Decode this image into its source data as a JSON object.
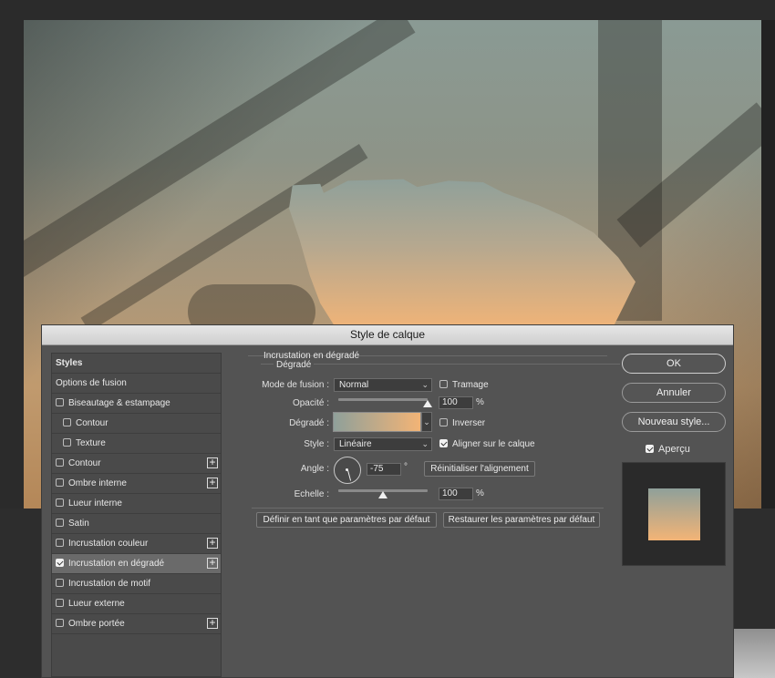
{
  "dialog": {
    "title": "Style de calque"
  },
  "styles_list": [
    {
      "label": "Styles",
      "header": true
    },
    {
      "label": "Options de fusion",
      "header": false
    },
    {
      "label": "Biseautage & estampage",
      "checked": false
    },
    {
      "label": "Contour",
      "checked": false,
      "indent": true
    },
    {
      "label": "Texture",
      "checked": false,
      "indent": true
    },
    {
      "label": "Contour",
      "checked": false,
      "plus": true
    },
    {
      "label": "Ombre interne",
      "checked": false,
      "plus": true
    },
    {
      "label": "Lueur interne",
      "checked": false
    },
    {
      "label": "Satin",
      "checked": false
    },
    {
      "label": "Incrustation couleur",
      "checked": false,
      "plus": true
    },
    {
      "label": "Incrustation en dégradé",
      "checked": true,
      "plus": true,
      "selected": true
    },
    {
      "label": "Incrustation de motif",
      "checked": false
    },
    {
      "label": "Lueur externe",
      "checked": false
    },
    {
      "label": "Ombre portée",
      "checked": false,
      "plus": true
    }
  ],
  "gradient_overlay": {
    "section_title": "Incrustation en dégradé",
    "group_title": "Dégradé",
    "blend_mode_label": "Mode de fusion :",
    "blend_mode_value": "Normal",
    "dither_label": "Tramage",
    "dither_checked": false,
    "opacity_label": "Opacité :",
    "opacity_value": "100",
    "opacity_unit": "%",
    "opacity_fraction": 1.0,
    "gradient_label": "Dégradé :",
    "gradient_colors": [
      "#8fa09a",
      "#f3b476"
    ],
    "reverse_label": "Inverser",
    "reverse_checked": false,
    "style_label": "Style :",
    "style_value": "Linéaire",
    "align_label": "Aligner sur le calque",
    "align_checked": true,
    "angle_label": "Angle :",
    "angle_value": "-75",
    "angle_unit": "°",
    "reset_align_button": "Réinitialiser l'alignement",
    "scale_label": "Echelle :",
    "scale_value": "100",
    "scale_unit": "%",
    "scale_fraction": 0.5,
    "set_default_button": "Définir en tant que paramètres par défaut",
    "restore_default_button": "Restaurer les paramètres par défaut"
  },
  "actions": {
    "ok": "OK",
    "cancel": "Annuler",
    "new_style": "Nouveau style...",
    "preview_label": "Aperçu",
    "preview_checked": true
  },
  "colors": {
    "dialog_bg": "#535353",
    "gradient_start": "#8fa09a",
    "gradient_end": "#f3b476"
  }
}
